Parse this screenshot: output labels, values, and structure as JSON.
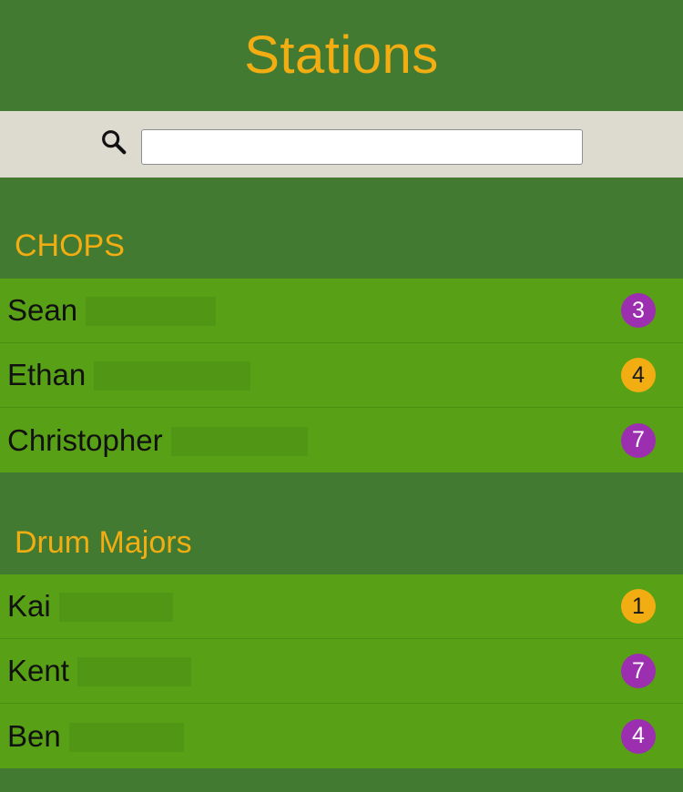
{
  "header": {
    "title": "Stations"
  },
  "search": {
    "placeholder": "",
    "value": ""
  },
  "colors": {
    "header_bg": "#437a31",
    "title": "#f2ad12",
    "row_bg": "#58a016",
    "badge_purple": "#9c2eb0",
    "badge_amber": "#f2ad12"
  },
  "sections": [
    {
      "title": "CHOPS",
      "rows": [
        {
          "name": "Sean",
          "count": "3",
          "badge_color": "purple"
        },
        {
          "name": "Ethan",
          "count": "4",
          "badge_color": "amber"
        },
        {
          "name": "Christopher",
          "count": "7",
          "badge_color": "purple"
        }
      ]
    },
    {
      "title": "Drum Majors",
      "rows": [
        {
          "name": "Kai",
          "count": "1",
          "badge_color": "amber"
        },
        {
          "name": "Kent",
          "count": "7",
          "badge_color": "purple"
        },
        {
          "name": "Ben",
          "count": "4",
          "badge_color": "purple"
        }
      ]
    }
  ]
}
